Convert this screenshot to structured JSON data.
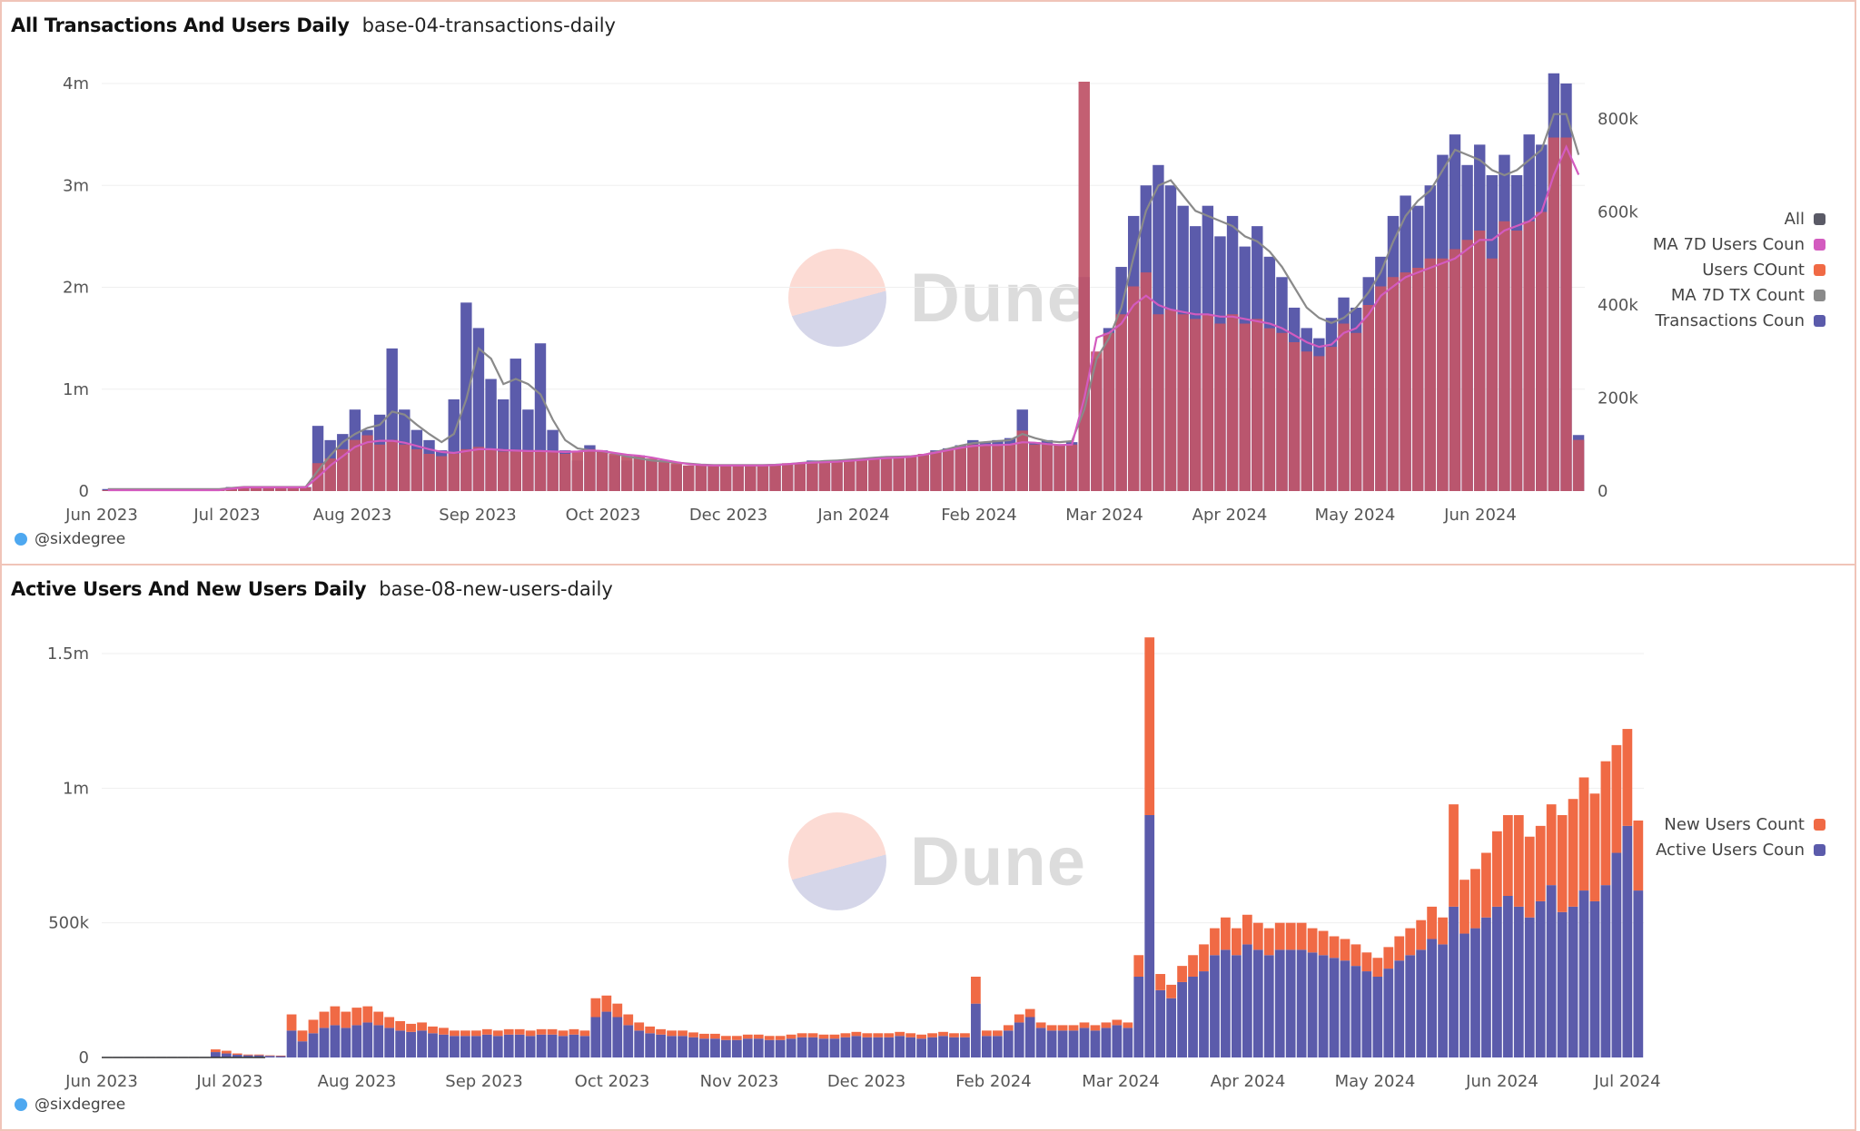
{
  "charts_meta": [
    {
      "title": "All Transactions And Users Daily",
      "query": "base-04-transactions-daily",
      "author": "@sixdegree",
      "watermark": "Dune"
    },
    {
      "title": "Active Users And New Users Daily",
      "query": "base-08-new-users-daily",
      "author": "@sixdegree",
      "watermark": "Dune"
    }
  ],
  "chart_data": [
    {
      "type": "bar",
      "title": "All Transactions And Users Daily",
      "subtitle": "base-04-transactions-daily",
      "x_range": [
        "2023-06-01",
        "2024-06-30"
      ],
      "x_step_days": 3,
      "x_ticks": [
        "Jun 2023",
        "Jul 2023",
        "Aug 2023",
        "Sep 2023",
        "Oct 2023",
        "Dec 2023",
        "Jan 2024",
        "Feb 2024",
        "Mar 2024",
        "Apr 2024",
        "May 2024",
        "Jun 2024"
      ],
      "y_left": {
        "ticks": [
          "0",
          "1m",
          "2m",
          "3m",
          "4m"
        ],
        "range": [
          0,
          4000000
        ]
      },
      "y_right": {
        "ticks": [
          "0",
          "200k",
          "400k",
          "600k",
          "800k"
        ],
        "range": [
          0,
          800000
        ]
      },
      "grid": true,
      "legend_position": "right",
      "legend": [
        {
          "name": "All",
          "color": "#5a5a66"
        },
        {
          "name": "MA 7D Users Coun",
          "color": "#d35bbf"
        },
        {
          "name": "Users COunt",
          "color": "#f06a45"
        },
        {
          "name": "MA 7D TX Count",
          "color": "#8a8a8a"
        },
        {
          "name": "Transactions Coun",
          "color": "#5b5bab"
        }
      ],
      "series": [
        {
          "name": "Transactions Count",
          "axis": "left",
          "kind": "bar",
          "color": "#5b5bab",
          "values": [
            20000,
            20000,
            20000,
            20000,
            20000,
            20000,
            20000,
            20000,
            20000,
            20000,
            40000,
            40000,
            40000,
            40000,
            40000,
            40000,
            40000,
            640000,
            500000,
            560000,
            800000,
            600000,
            750000,
            1400000,
            800000,
            600000,
            500000,
            400000,
            900000,
            1850000,
            1600000,
            1100000,
            900000,
            1300000,
            800000,
            1450000,
            600000,
            400000,
            300000,
            450000,
            400000,
            350000,
            300000,
            350000,
            300000,
            280000,
            260000,
            250000,
            250000,
            250000,
            250000,
            260000,
            250000,
            250000,
            250000,
            270000,
            280000,
            300000,
            290000,
            300000,
            310000,
            320000,
            330000,
            340000,
            330000,
            340000,
            350000,
            400000,
            420000,
            450000,
            500000,
            480000,
            500000,
            520000,
            800000,
            480000,
            500000,
            460000,
            480000,
            2100000,
            1300000,
            1600000,
            2200000,
            2700000,
            3000000,
            3200000,
            3000000,
            2800000,
            2600000,
            2800000,
            2500000,
            2700000,
            2400000,
            2600000,
            2300000,
            2100000,
            1800000,
            1600000,
            1500000,
            1700000,
            1900000,
            1800000,
            2100000,
            2300000,
            2700000,
            2900000,
            2800000,
            3000000,
            3300000,
            3500000,
            3200000,
            3400000,
            3100000,
            3300000,
            3100000,
            3500000,
            3400000,
            4100000,
            4000000,
            550000
          ]
        },
        {
          "name": "Users COunt",
          "axis": "right",
          "kind": "area",
          "color": "#c0566a",
          "values": [
            2000,
            2000,
            2000,
            2000,
            2000,
            2000,
            2000,
            2000,
            2000,
            2000,
            8000,
            8000,
            8000,
            8000,
            8000,
            8000,
            8000,
            60000,
            70000,
            90000,
            110000,
            120000,
            100000,
            110000,
            100000,
            90000,
            80000,
            75000,
            80000,
            90000,
            95000,
            90000,
            85000,
            85000,
            85000,
            85000,
            85000,
            80000,
            85000,
            90000,
            85000,
            80000,
            75000,
            75000,
            70000,
            65000,
            60000,
            55000,
            55000,
            55000,
            55000,
            56000,
            55000,
            55000,
            55000,
            60000,
            60000,
            62000,
            62000,
            64000,
            65000,
            68000,
            70000,
            72000,
            72000,
            75000,
            80000,
            85000,
            90000,
            95000,
            100000,
            100000,
            98000,
            100000,
            130000,
            100000,
            100000,
            98000,
            100000,
            880000,
            300000,
            340000,
            380000,
            440000,
            470000,
            380000,
            390000,
            380000,
            370000,
            380000,
            360000,
            380000,
            360000,
            370000,
            350000,
            340000,
            320000,
            300000,
            290000,
            310000,
            360000,
            340000,
            400000,
            440000,
            460000,
            470000,
            480000,
            500000,
            500000,
            520000,
            540000,
            560000,
            500000,
            580000,
            560000,
            580000,
            600000,
            760000,
            760000,
            110000
          ]
        },
        {
          "name": "MA 7D TX Count",
          "axis": "left",
          "kind": "line",
          "color": "#8a8a8a",
          "values": [
            20000,
            20000,
            20000,
            20000,
            20000,
            20000,
            20000,
            20000,
            20000,
            20000,
            30000,
            40000,
            40000,
            40000,
            40000,
            40000,
            40000,
            200000,
            350000,
            480000,
            560000,
            620000,
            650000,
            780000,
            750000,
            650000,
            560000,
            480000,
            560000,
            900000,
            1400000,
            1300000,
            1050000,
            1100000,
            1050000,
            950000,
            700000,
            500000,
            420000,
            400000,
            390000,
            370000,
            340000,
            320000,
            300000,
            290000,
            280000,
            270000,
            260000,
            255000,
            255000,
            255000,
            255000,
            255000,
            258000,
            265000,
            275000,
            285000,
            295000,
            300000,
            308000,
            318000,
            328000,
            335000,
            338000,
            342000,
            355000,
            385000,
            415000,
            445000,
            470000,
            480000,
            490000,
            500000,
            560000,
            520000,
            490000,
            480000,
            490000,
            800000,
            1300000,
            1500000,
            1800000,
            2300000,
            2750000,
            3000000,
            3050000,
            2900000,
            2750000,
            2700000,
            2650000,
            2600000,
            2500000,
            2450000,
            2350000,
            2200000,
            2000000,
            1800000,
            1700000,
            1650000,
            1700000,
            1800000,
            1950000,
            2150000,
            2450000,
            2700000,
            2850000,
            2950000,
            3150000,
            3350000,
            3300000,
            3250000,
            3150000,
            3100000,
            3150000,
            3250000,
            3350000,
            3700000,
            3700000,
            3300000
          ]
        },
        {
          "name": "MA 7D Users Count",
          "axis": "right",
          "kind": "line",
          "color": "#d35bbf",
          "values": [
            2000,
            2000,
            2000,
            2000,
            2000,
            2000,
            2000,
            2000,
            2000,
            2000,
            5000,
            8000,
            8000,
            8000,
            8000,
            8000,
            8000,
            30000,
            55000,
            75000,
            95000,
            105000,
            108000,
            108000,
            104000,
            97000,
            90000,
            84000,
            82000,
            86000,
            90000,
            90000,
            88000,
            87000,
            86000,
            86000,
            85000,
            84000,
            85000,
            87000,
            86000,
            82000,
            78000,
            76000,
            72000,
            67000,
            62000,
            58000,
            56000,
            55000,
            55000,
            55000,
            55000,
            55000,
            56000,
            58000,
            60000,
            61000,
            62000,
            63000,
            65000,
            67000,
            69000,
            71000,
            72000,
            74000,
            78000,
            83000,
            88000,
            93000,
            97000,
            99000,
            99000,
            100000,
            105000,
            104000,
            101000,
            99000,
            100000,
            200000,
            330000,
            340000,
            360000,
            400000,
            420000,
            400000,
            390000,
            385000,
            380000,
            380000,
            375000,
            375000,
            370000,
            365000,
            360000,
            350000,
            335000,
            320000,
            310000,
            315000,
            340000,
            350000,
            380000,
            420000,
            440000,
            460000,
            470000,
            480000,
            490000,
            500000,
            520000,
            540000,
            540000,
            560000,
            570000,
            580000,
            600000,
            680000,
            740000,
            680000
          ]
        }
      ]
    },
    {
      "type": "bar",
      "stacked": true,
      "title": "Active Users And New Users Daily",
      "subtitle": "base-08-new-users-daily",
      "x_range": [
        "2023-06-01",
        "2024-07-10"
      ],
      "x_step_days": 3,
      "x_ticks": [
        "Jun 2023",
        "Jul 2023",
        "Aug 2023",
        "Sep 2023",
        "Oct 2023",
        "Nov 2023",
        "Dec 2023",
        "Feb 2024",
        "Mar 2024",
        "Apr 2024",
        "May 2024",
        "Jun 2024",
        "Jul 2024"
      ],
      "y_left": {
        "ticks": [
          "0",
          "500k",
          "1m",
          "1.5m"
        ],
        "range": [
          0,
          1500000
        ]
      },
      "grid": true,
      "legend_position": "right",
      "legend": [
        {
          "name": "New Users Count",
          "color": "#f06a45"
        },
        {
          "name": "Active Users Coun",
          "color": "#5b5bab"
        }
      ],
      "series": [
        {
          "name": "Active Users Count",
          "kind": "bar",
          "color": "#5b5bab",
          "values": [
            2000,
            2000,
            2000,
            2000,
            2000,
            2000,
            2000,
            2000,
            2000,
            2000,
            20000,
            15000,
            10000,
            8000,
            8000,
            6000,
            5000,
            100000,
            60000,
            90000,
            110000,
            120000,
            110000,
            120000,
            130000,
            120000,
            110000,
            100000,
            95000,
            100000,
            90000,
            85000,
            80000,
            80000,
            80000,
            85000,
            80000,
            85000,
            85000,
            80000,
            85000,
            85000,
            80000,
            85000,
            80000,
            150000,
            170000,
            150000,
            120000,
            100000,
            90000,
            85000,
            80000,
            80000,
            75000,
            70000,
            70000,
            65000,
            65000,
            70000,
            70000,
            65000,
            65000,
            70000,
            75000,
            75000,
            70000,
            70000,
            75000,
            80000,
            75000,
            75000,
            75000,
            80000,
            75000,
            70000,
            75000,
            80000,
            75000,
            75000,
            200000,
            80000,
            80000,
            100000,
            130000,
            150000,
            110000,
            100000,
            100000,
            100000,
            110000,
            100000,
            110000,
            120000,
            110000,
            300000,
            900000,
            250000,
            220000,
            280000,
            300000,
            320000,
            380000,
            400000,
            380000,
            420000,
            400000,
            380000,
            400000,
            400000,
            400000,
            390000,
            380000,
            370000,
            360000,
            340000,
            320000,
            300000,
            330000,
            360000,
            380000,
            400000,
            440000,
            420000,
            560000,
            460000,
            480000,
            520000,
            560000,
            600000,
            560000,
            520000,
            580000,
            640000,
            540000,
            560000,
            620000,
            580000,
            640000,
            760000,
            860000,
            620000
          ]
        },
        {
          "name": "New Users Count",
          "kind": "bar",
          "color": "#f06a45",
          "values": [
            0,
            0,
            0,
            0,
            0,
            0,
            0,
            0,
            0,
            0,
            10000,
            10000,
            5000,
            3000,
            3000,
            2000,
            2000,
            60000,
            40000,
            50000,
            60000,
            70000,
            60000,
            65000,
            60000,
            50000,
            40000,
            35000,
            30000,
            30000,
            25000,
            25000,
            20000,
            20000,
            20000,
            20000,
            20000,
            20000,
            20000,
            20000,
            20000,
            20000,
            20000,
            20000,
            20000,
            70000,
            60000,
            50000,
            40000,
            30000,
            25000,
            20000,
            20000,
            20000,
            18000,
            18000,
            18000,
            15000,
            15000,
            15000,
            15000,
            15000,
            15000,
            15000,
            15000,
            15000,
            15000,
            15000,
            15000,
            15000,
            15000,
            15000,
            15000,
            15000,
            15000,
            15000,
            15000,
            15000,
            15000,
            15000,
            100000,
            20000,
            20000,
            20000,
            30000,
            30000,
            20000,
            20000,
            20000,
            20000,
            20000,
            20000,
            20000,
            20000,
            20000,
            80000,
            660000,
            60000,
            50000,
            60000,
            80000,
            100000,
            100000,
            120000,
            100000,
            110000,
            100000,
            100000,
            100000,
            100000,
            100000,
            90000,
            90000,
            80000,
            80000,
            80000,
            70000,
            70000,
            80000,
            90000,
            100000,
            110000,
            120000,
            100000,
            380000,
            200000,
            220000,
            240000,
            280000,
            300000,
            340000,
            300000,
            280000,
            300000,
            360000,
            400000,
            420000,
            400000,
            460000,
            400000,
            360000,
            260000
          ]
        }
      ]
    }
  ]
}
